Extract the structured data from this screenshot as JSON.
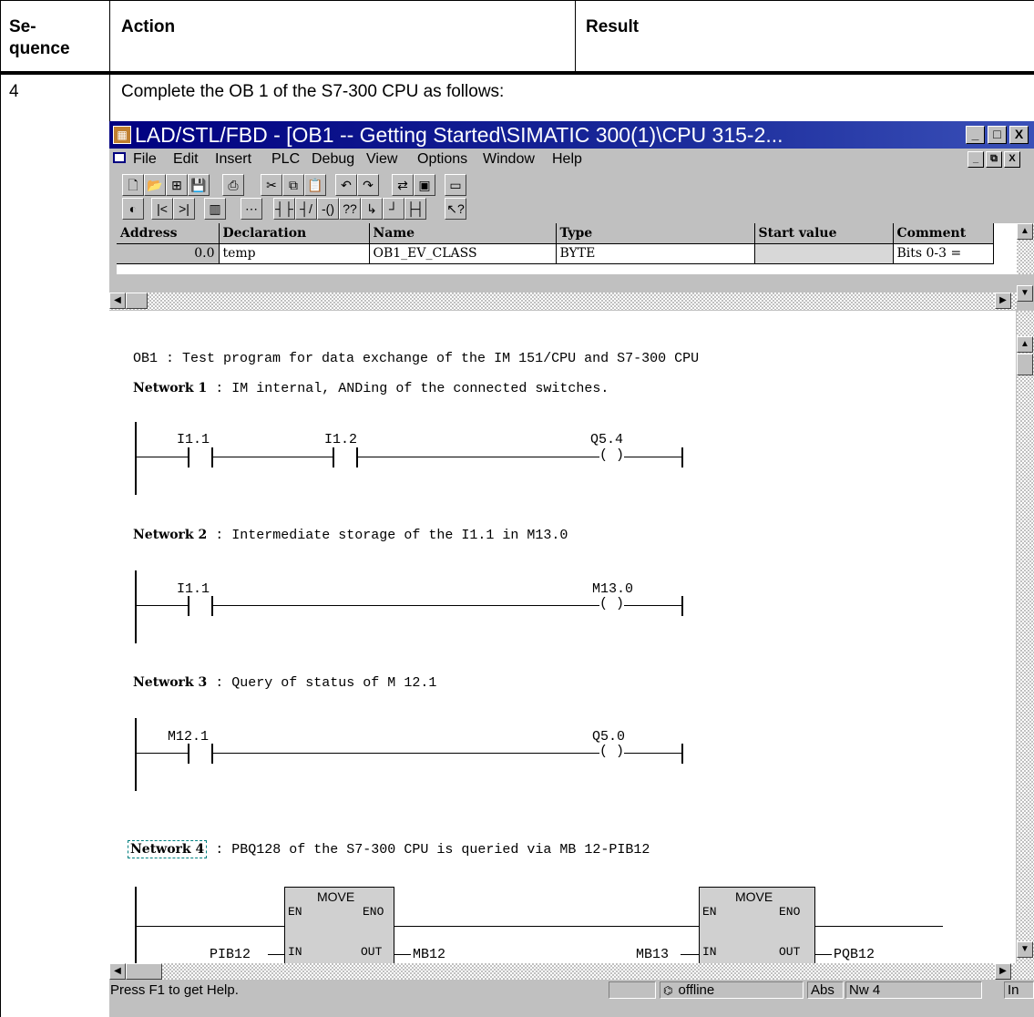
{
  "table": {
    "headers": [
      "Se-",
      "quence",
      "Action",
      "Result"
    ],
    "sequence": "4",
    "instruction": "Complete the OB 1 of the S7-300 CPU as follows:"
  },
  "window": {
    "title": "LAD/STL/FBD  - [OB1 -- Getting Started\\SIMATIC 300(1)\\CPU 315-2...",
    "caption_buttons": [
      "_",
      "□",
      "X"
    ],
    "menu": [
      "File",
      "Edit",
      "Insert",
      "PLC",
      "Debug",
      "View",
      "Options",
      "Window",
      "Help"
    ],
    "mdi_buttons": [
      "_",
      "⧉",
      "X"
    ]
  },
  "toolbar1": [
    {
      "icon": "new-icon",
      "glyph": "🗋"
    },
    {
      "icon": "open-icon",
      "glyph": "📂"
    },
    {
      "icon": "accessible-nodes-icon",
      "glyph": "⊞"
    },
    {
      "icon": "save-icon",
      "glyph": "💾"
    },
    {
      "icon": "print-icon",
      "glyph": "⎙"
    },
    {
      "icon": "cut-icon",
      "glyph": "✂"
    },
    {
      "icon": "copy-icon",
      "glyph": "⧉"
    },
    {
      "icon": "paste-icon",
      "glyph": "📋"
    },
    {
      "icon": "undo-icon",
      "glyph": "↶"
    },
    {
      "icon": "redo-icon",
      "glyph": "↷"
    },
    {
      "icon": "online-offline-icon",
      "glyph": "⇄"
    },
    {
      "icon": "download-icon",
      "glyph": "▣"
    },
    {
      "icon": "overview-icon",
      "glyph": "▭"
    }
  ],
  "toolbar2": [
    {
      "icon": "monitor-icon",
      "glyph": "◐"
    },
    {
      "icon": "first-network-icon",
      "glyph": "|<"
    },
    {
      "icon": "last-network-icon",
      "glyph": ">|"
    },
    {
      "icon": "block-icon",
      "glyph": "▥"
    },
    {
      "icon": "new-network-icon",
      "glyph": "⋯"
    },
    {
      "icon": "contact-no-icon",
      "glyph": "┤├"
    },
    {
      "icon": "contact-nc-icon",
      "glyph": "┤/├"
    },
    {
      "icon": "coil-icon",
      "glyph": "-()"
    },
    {
      "icon": "empty-box-icon",
      "glyph": "??"
    },
    {
      "icon": "open-branch-icon",
      "glyph": "↳"
    },
    {
      "icon": "close-branch-icon",
      "glyph": "┘"
    },
    {
      "icon": "connection-icon",
      "glyph": "├┤"
    },
    {
      "icon": "help-cursor-icon",
      "glyph": "↖?"
    }
  ],
  "declaration": {
    "headers": [
      "Address",
      "Declaration",
      "Name",
      "Type",
      "Start value",
      "Comment"
    ],
    "row": [
      "0.0",
      "temp",
      "OB1_EV_CLASS",
      "BYTE",
      "",
      "Bits 0-3 ="
    ]
  },
  "editor": {
    "block_title": "OB1 : Test program for data exchange of the IM 151/CPU and S7-300 CPU",
    "networks": [
      {
        "label": "Network 1",
        "title": ": IM internal, ANDing of the connected switches.",
        "contacts": [
          "I1.1",
          "I1.2"
        ],
        "coil": "Q5.4"
      },
      {
        "label": "Network 2",
        "title": ": Intermediate storage of the I1.1 in M13.0",
        "contacts": [
          "I1.1"
        ],
        "coil": "M13.0"
      },
      {
        "label": "Network 3",
        "title": ": Query of status of M 12.1",
        "contacts": [
          "M12.1"
        ],
        "coil": "Q5.0"
      },
      {
        "label": "Network 4",
        "title": ": PBQ128 of the S7-300 CPU is queried via MB 12-PIB12",
        "boxes": [
          {
            "name": "MOVE",
            "en": "EN",
            "eno": "ENO",
            "in": "IN",
            "out": "OUT",
            "in_op": "PIB12",
            "out_op": "MB12"
          },
          {
            "name": "MOVE",
            "en": "EN",
            "eno": "ENO",
            "in": "IN",
            "out": "OUT",
            "in_op": "MB13",
            "out_op": "PQB12"
          }
        ]
      }
    ],
    "coil_symbol": "( )"
  },
  "status": {
    "help": "Press F1 to get Help.",
    "mode": "offline",
    "abs": "Abs",
    "network": "Nw 4",
    "insert": "In"
  },
  "colors": {
    "titlebar": "#000080",
    "chrome": "#c0c0c0"
  }
}
